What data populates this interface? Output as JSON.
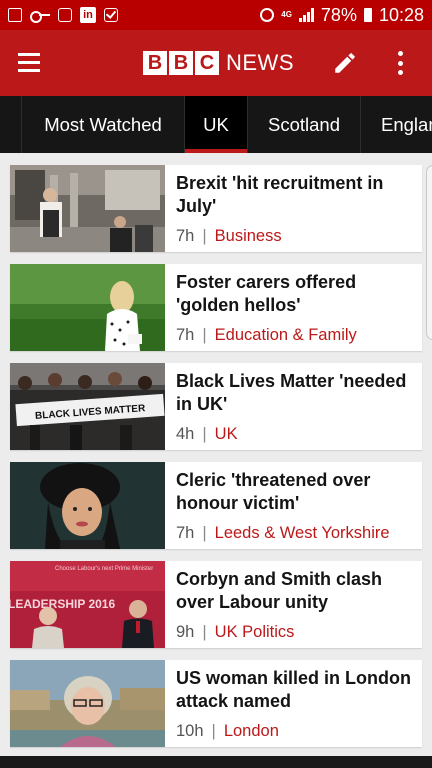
{
  "status_bar": {
    "icons": [
      "screenshot-icon",
      "key-icon",
      "square-icon",
      "linkedin-icon",
      "checkbox-icon",
      "alarm-icon",
      "network-icon",
      "signal-icon",
      "battery-icon"
    ],
    "linkedin_label": "in",
    "network_label": "4G",
    "battery": "78%",
    "time": "10:28"
  },
  "app_bar": {
    "logo_letters": [
      "B",
      "B",
      "C"
    ],
    "logo_text": "NEWS",
    "brand_color": "#bb1919"
  },
  "tabs": [
    {
      "label": "",
      "active": false
    },
    {
      "label": "Most Watched",
      "active": false
    },
    {
      "label": "UK",
      "active": true
    },
    {
      "label": "Scotland",
      "active": false
    },
    {
      "label": "England",
      "active": false
    }
  ],
  "stories": [
    {
      "title": "Brexit 'hit recruitment in July'",
      "age": "7h",
      "topic": "Business"
    },
    {
      "title": "Foster carers offered 'golden hellos'",
      "age": "7h",
      "topic": "Education & Family"
    },
    {
      "title": "Black Lives Matter 'needed in UK'",
      "age": "4h",
      "topic": "UK",
      "banner_text": "BLACK LIVES MATTER"
    },
    {
      "title": "Cleric 'threatened over honour victim'",
      "age": "7h",
      "topic": "Leeds & West Yorkshire"
    },
    {
      "title": "Corbyn and Smith clash over Labour unity",
      "age": "9h",
      "topic": "UK Politics",
      "banner_text": "Choose Labour's next Prime Minister",
      "banner_big": "LEADERSHIP 2016"
    },
    {
      "title": "US woman killed in London attack named",
      "age": "10h",
      "topic": "London"
    }
  ],
  "meta_separator": "|"
}
